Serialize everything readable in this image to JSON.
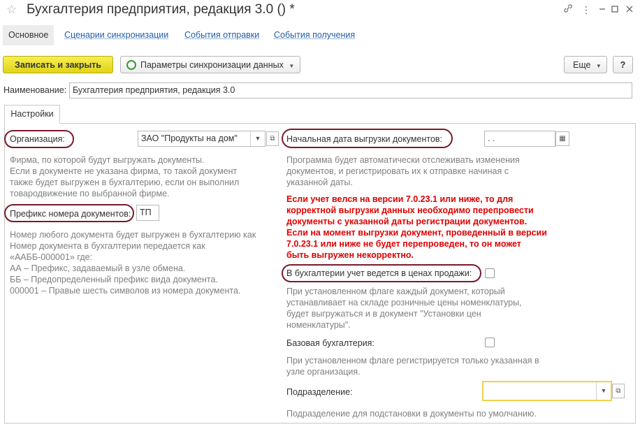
{
  "window": {
    "title": "Бухгалтерия предприятия, редакция 3.0 () *"
  },
  "nav_tabs": [
    {
      "label": "Основное"
    },
    {
      "label": "Сценарии синхронизации"
    },
    {
      "label": "События отправки"
    },
    {
      "label": "События получения"
    }
  ],
  "toolbar": {
    "save_close_label": "Записать и закрыть",
    "sync_params_label": "Параметры синхронизации данных",
    "more_label": "Еще",
    "help_label": "?"
  },
  "name_field": {
    "label": "Наименование:",
    "value": "Бухгалтерия предприятия, редакция 3.0"
  },
  "settings_tab": {
    "label": "Настройки"
  },
  "left": {
    "org_label": "Организация:",
    "org_value": "ЗАО \"Продукты на дом\"",
    "org_hint": [
      "Фирма, по которой будут выгружать документы.",
      "Если в документе не указана фирма, то такой документ",
      "также будет выгружен в бухгалтерию, если он выполнил",
      "товародвижение по выбранной фирме."
    ],
    "prefix_label": "Префикс номера документов:",
    "prefix_value": "ТП",
    "prefix_hint": [
      "Номер любого документа будет выгружен в бухгалтерию как",
      "Номер документа в бухгалтерии передается как",
      "«ААББ-000001» где:",
      "АА – Префикс, задаваемый в узле обмена.",
      "ББ – Предопределенный префикс вида документа.",
      "000001 – Правые шесть символов из номера документа."
    ]
  },
  "right": {
    "start_date_label": "Начальная дата выгрузки документов:",
    "start_date_value": " .  .",
    "start_date_hint": [
      "Программа будет автоматически отслеживать изменения",
      "документов, и регистрировать их к отправке начиная с",
      "указанной даты."
    ],
    "warning": [
      "Если учет велся на версии 7.0.23.1 или ниже, то для",
      "корректной выгрузки данных необходимо перепровести",
      "документы с указанной даты регистрации документов.",
      "Если на момент выгрузки документ, проведенный в версии",
      "7.0.23.1 или ниже не будет перепроведен, то он может",
      "быть выгружен некорректно."
    ],
    "retail_prices_label": "В бухгалтерии учет ведется в ценах продажи:",
    "retail_prices_hint": [
      "При установленном флаге каждый документ, который",
      "устанавливает на складе розничные цены номенклатуры,",
      "будет выгружаться и в документ \"Установки цен",
      "номенклатуры\"."
    ],
    "base_accounting_label": "Базовая бухгалтерия:",
    "base_accounting_hint": [
      "При установленном флаге регистрируется только указанная в",
      "узле организация."
    ],
    "division_label": "Подразделение:",
    "division_value": "",
    "division_hint": [
      "Подразделение для подстановки в документы по умолчанию."
    ]
  }
}
